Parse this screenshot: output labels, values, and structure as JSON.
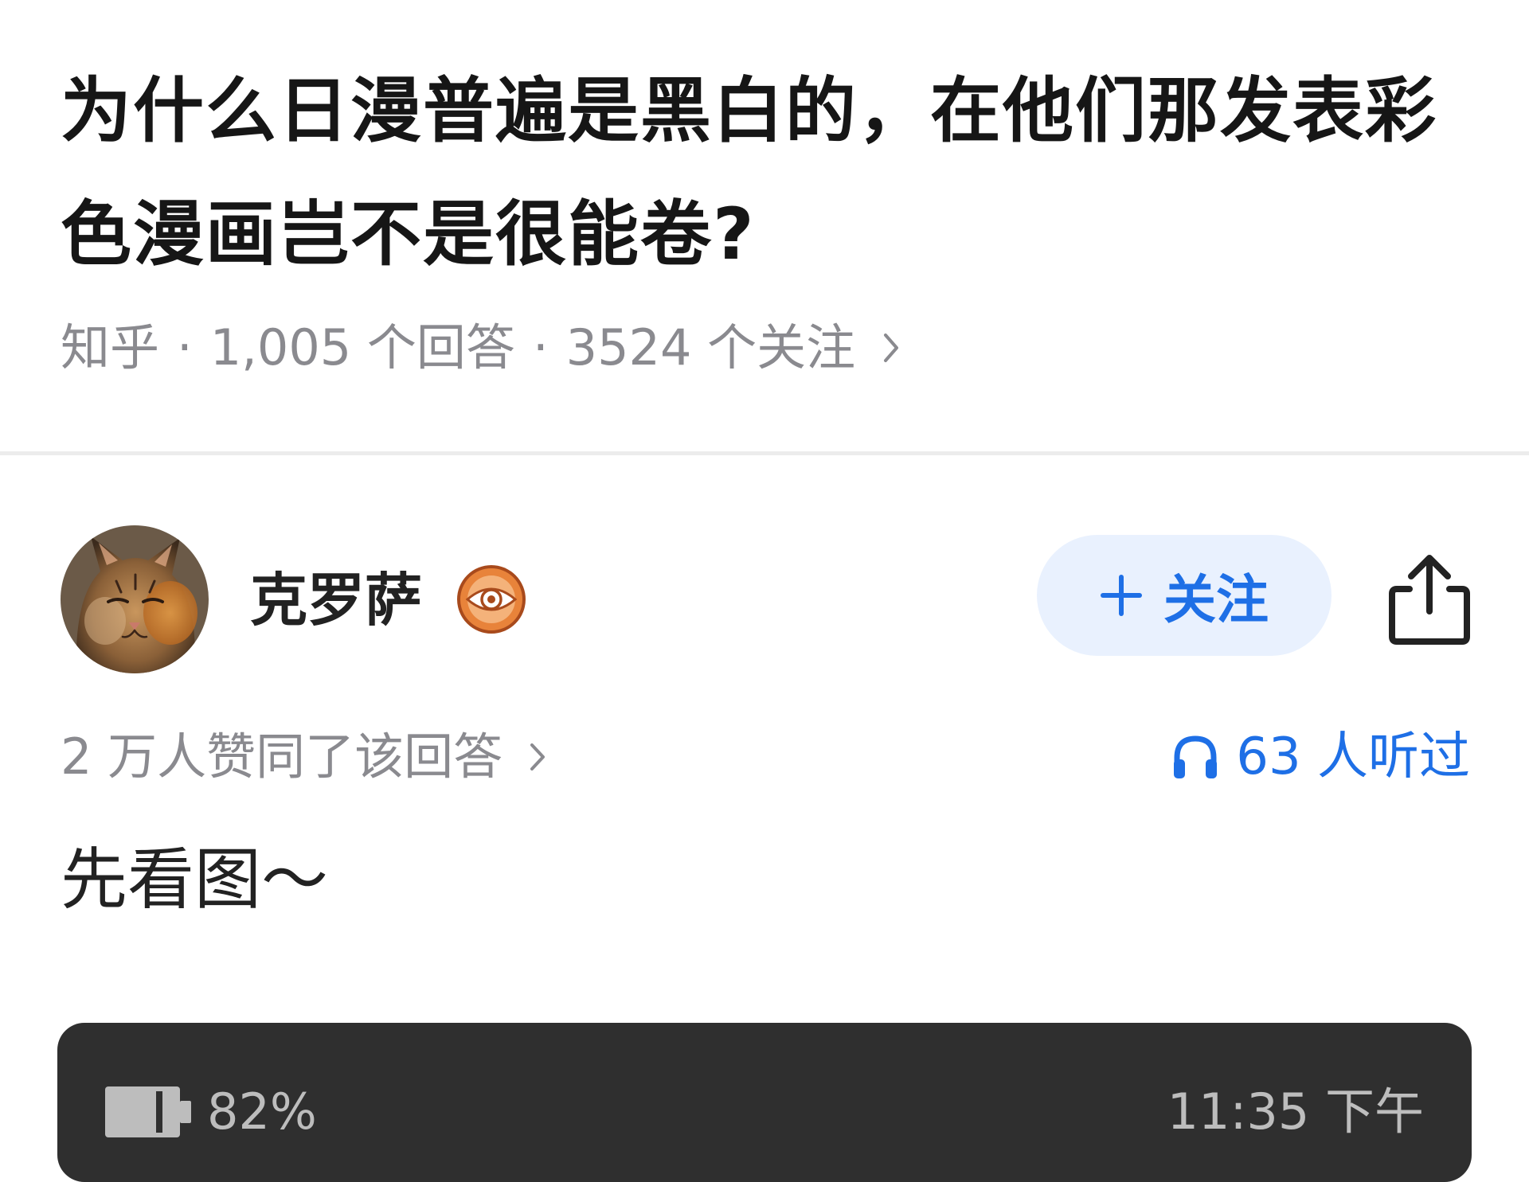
{
  "question": {
    "title": "为什么日漫普遍是黑白的，在他们那发表彩色漫画岂不是很能卷?",
    "source": "知乎",
    "answer_count": "1,005 个回答",
    "follow_count": "3524 个关注"
  },
  "author": {
    "name": "克罗萨",
    "avatar_icon": "cat-avatar",
    "badge_icon": "eye-badge-icon",
    "follow_label": "关注",
    "share_icon": "share-icon"
  },
  "stats": {
    "agree_text": "2 万人赞同了该回答",
    "listen_text": "63 人听过"
  },
  "answer": {
    "intro": "先看图～"
  },
  "embedded_screenshot": {
    "battery": "82%",
    "time": "11:35 下午"
  },
  "colors": {
    "accent": "#1e6fe6",
    "follow_bg": "#e9f1fe",
    "muted_text": "#8a8a8f",
    "badge_orange": "#e8833a",
    "embedded_bg": "#2f2f2f"
  }
}
